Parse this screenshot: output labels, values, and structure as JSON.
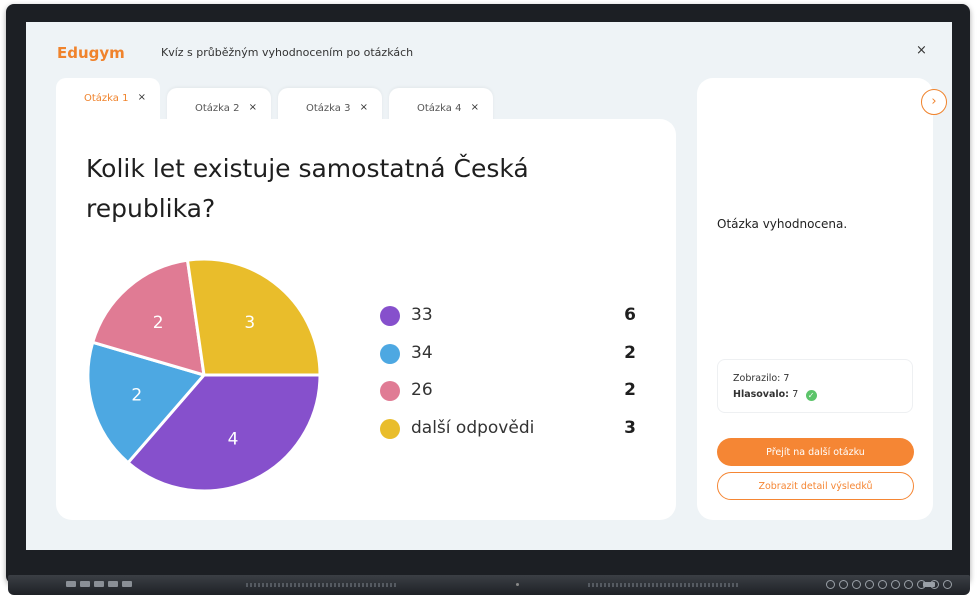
{
  "app": {
    "logo": "Edugym",
    "title": "Kvíz s průběžným vyhodnocením po otázkách",
    "close_symbol": "×"
  },
  "tabs": [
    {
      "label": "Otázka 1",
      "close": "×",
      "active": true
    },
    {
      "label": "Otázka 2",
      "close": "×",
      "active": false
    },
    {
      "label": "Otázka 3",
      "close": "×",
      "active": false
    },
    {
      "label": "Otázka 4",
      "close": "×",
      "active": false
    }
  ],
  "question": {
    "text": "Kolik let existuje samostatná Česká republika?"
  },
  "chart_data": {
    "type": "pie",
    "slices": [
      {
        "label": "33",
        "value": 4,
        "color": "#8650cc"
      },
      {
        "label": "34",
        "value": 2,
        "color": "#4da8e2"
      },
      {
        "label": "26",
        "value": 2,
        "color": "#e07b94"
      },
      {
        "label": "další odpovědi",
        "value": 3,
        "color": "#e9bd2b"
      }
    ]
  },
  "legend": [
    {
      "label": "33",
      "count": "6",
      "color": "#8650cc"
    },
    {
      "label": "34",
      "count": "2",
      "color": "#4da8e2"
    },
    {
      "label": "26",
      "count": "2",
      "color": "#e07b94"
    },
    {
      "label": "další odpovědi",
      "count": "3",
      "color": "#e9bd2b"
    }
  ],
  "side": {
    "next_symbol": "›",
    "status": "Otázka vyhodnocena.",
    "shown_label": "Zobrazilo:",
    "shown_value": "7",
    "voted_label": "Hlasovalo:",
    "voted_value": "7",
    "check_symbol": "✓",
    "primary_button": "Přejít na další otázku",
    "secondary_button": "Zobrazit detail výsledků"
  },
  "colors": {
    "accent": "#f0832c",
    "success": "#5cc46a"
  }
}
